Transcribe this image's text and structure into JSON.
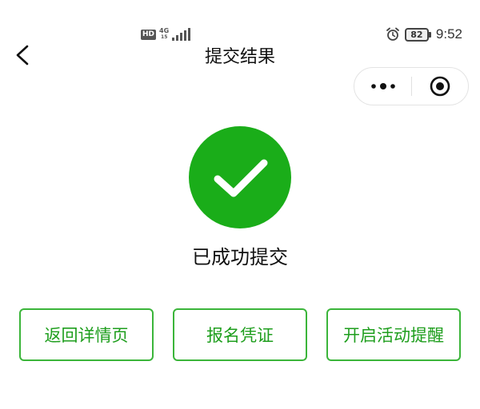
{
  "status_bar": {
    "hd_label": "HD",
    "network_type": "4G",
    "network_sub": "15",
    "battery_level": "82",
    "time": "9:52"
  },
  "nav": {
    "title": "提交结果",
    "back_icon": "chevron-left-icon",
    "capsule_more_icon": "more-dots-icon",
    "capsule_close_icon": "target-close-icon"
  },
  "result": {
    "icon": "check-circle-icon",
    "message": "已成功提交",
    "accent_color": "#1aad19"
  },
  "actions": {
    "back_to_detail": "返回详情页",
    "registration_voucher": "报名凭证",
    "activity_reminder": "开启活动提醒"
  }
}
